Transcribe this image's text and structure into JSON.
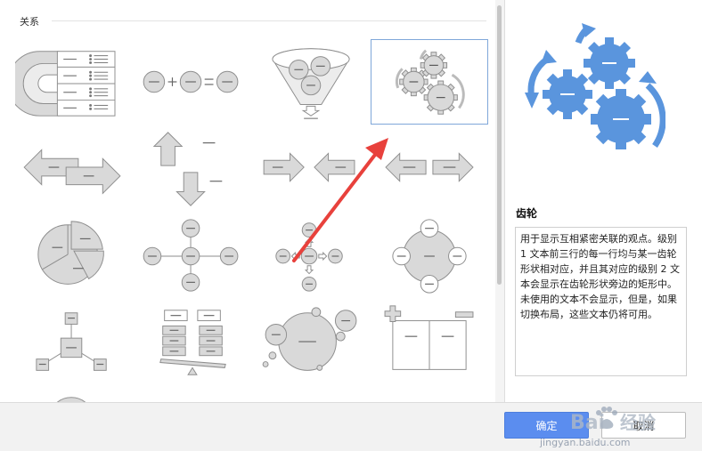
{
  "gallery": {
    "section_title": "关系"
  },
  "preview": {
    "title": "齿轮",
    "description": "用于显示互相紧密关联的观点。级别 1 文本前三行的每一行均与某一齿轮形状相对应，并且其对应的级别 2 文本会显示在齿轮形状旁边的矩形中。未使用的文本不会显示，但是，如果切换布局，这些文本仍将可用。"
  },
  "buttons": {
    "ok_label": "确定",
    "cancel_label": "取消"
  },
  "watermark": {
    "line1": "Bai",
    "line2": "经验",
    "line3": "jingyan.baidu.com"
  },
  "colors": {
    "accent": "#5b8def",
    "gear_blue": "#5a95dd",
    "thumb_gray": "#d9d9d9",
    "thumb_stroke": "#8e8e8e",
    "annotation_red": "#e8413c"
  },
  "icons": [
    "gear-icon",
    "cycle-arrow-icon",
    "annotation-arrow-icon"
  ]
}
